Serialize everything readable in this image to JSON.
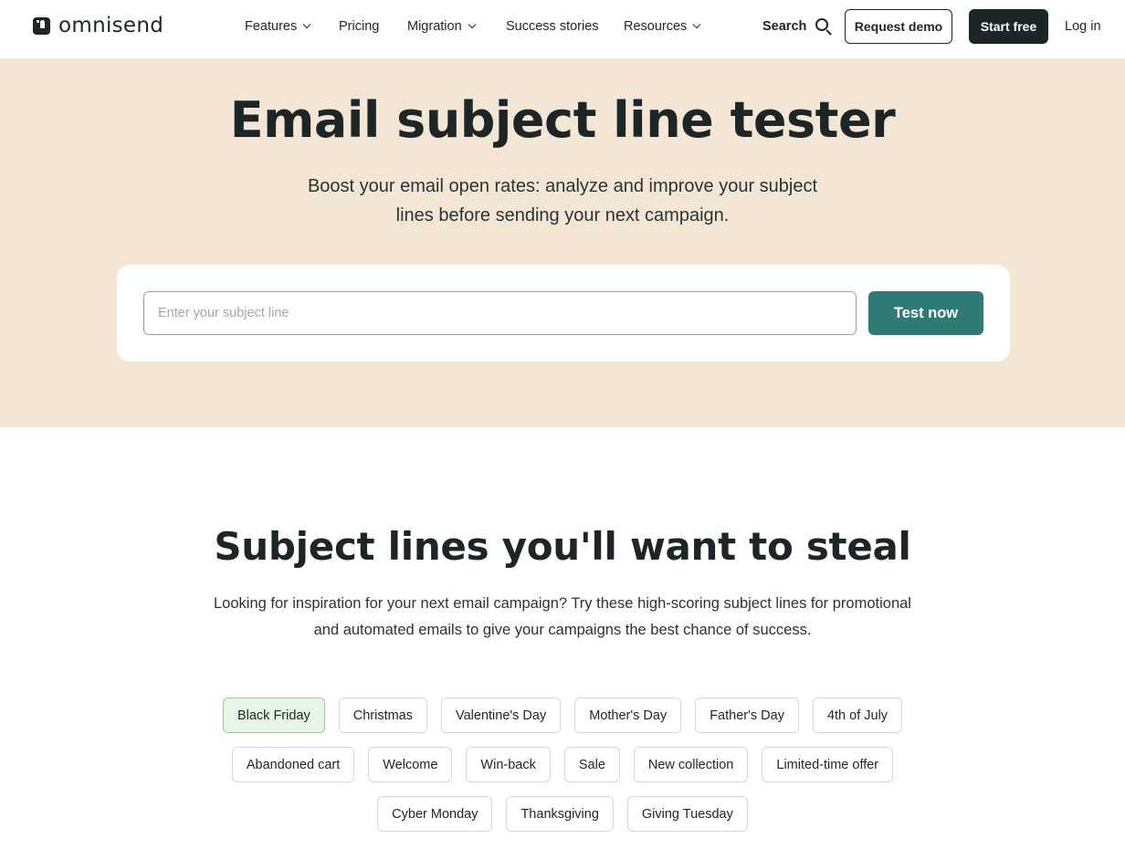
{
  "header": {
    "logo_text": "omnisend",
    "nav": {
      "features": "Features",
      "pricing": "Pricing",
      "migration": "Migration",
      "success_stories": "Success stories",
      "resources": "Resources"
    },
    "search_label": "Search",
    "request_demo": "Request demo",
    "start_free": "Start free",
    "log_in": "Log in"
  },
  "hero": {
    "title": "Email subject line tester",
    "subtitle": "Boost your email open rates: analyze and improve your subject lines before sending your next campaign.",
    "input_placeholder": "Enter your subject line",
    "input_value": "",
    "test_button": "Test now",
    "background_color": "#f3e6d4",
    "button_color": "#2e7b76"
  },
  "inspiration": {
    "title": "Subject lines you'll want to steal",
    "description": "Looking for inspiration for your next email campaign? Try these high-scoring subject lines for promotional and automated emails to give your campaigns the best chance of success.",
    "selected_category": "Black Friday",
    "categories_row1": [
      "Black Friday",
      "Christmas",
      "Valentine's Day",
      "Mother's Day",
      "Father's Day",
      "4th of July"
    ],
    "categories_row2": [
      "Abandoned cart",
      "Welcome",
      "Win-back",
      "Sale",
      "New collection",
      "Limited-time offer"
    ],
    "categories_row3": [
      "Cyber Monday",
      "Thanksgiving",
      "Giving Tuesday"
    ]
  }
}
